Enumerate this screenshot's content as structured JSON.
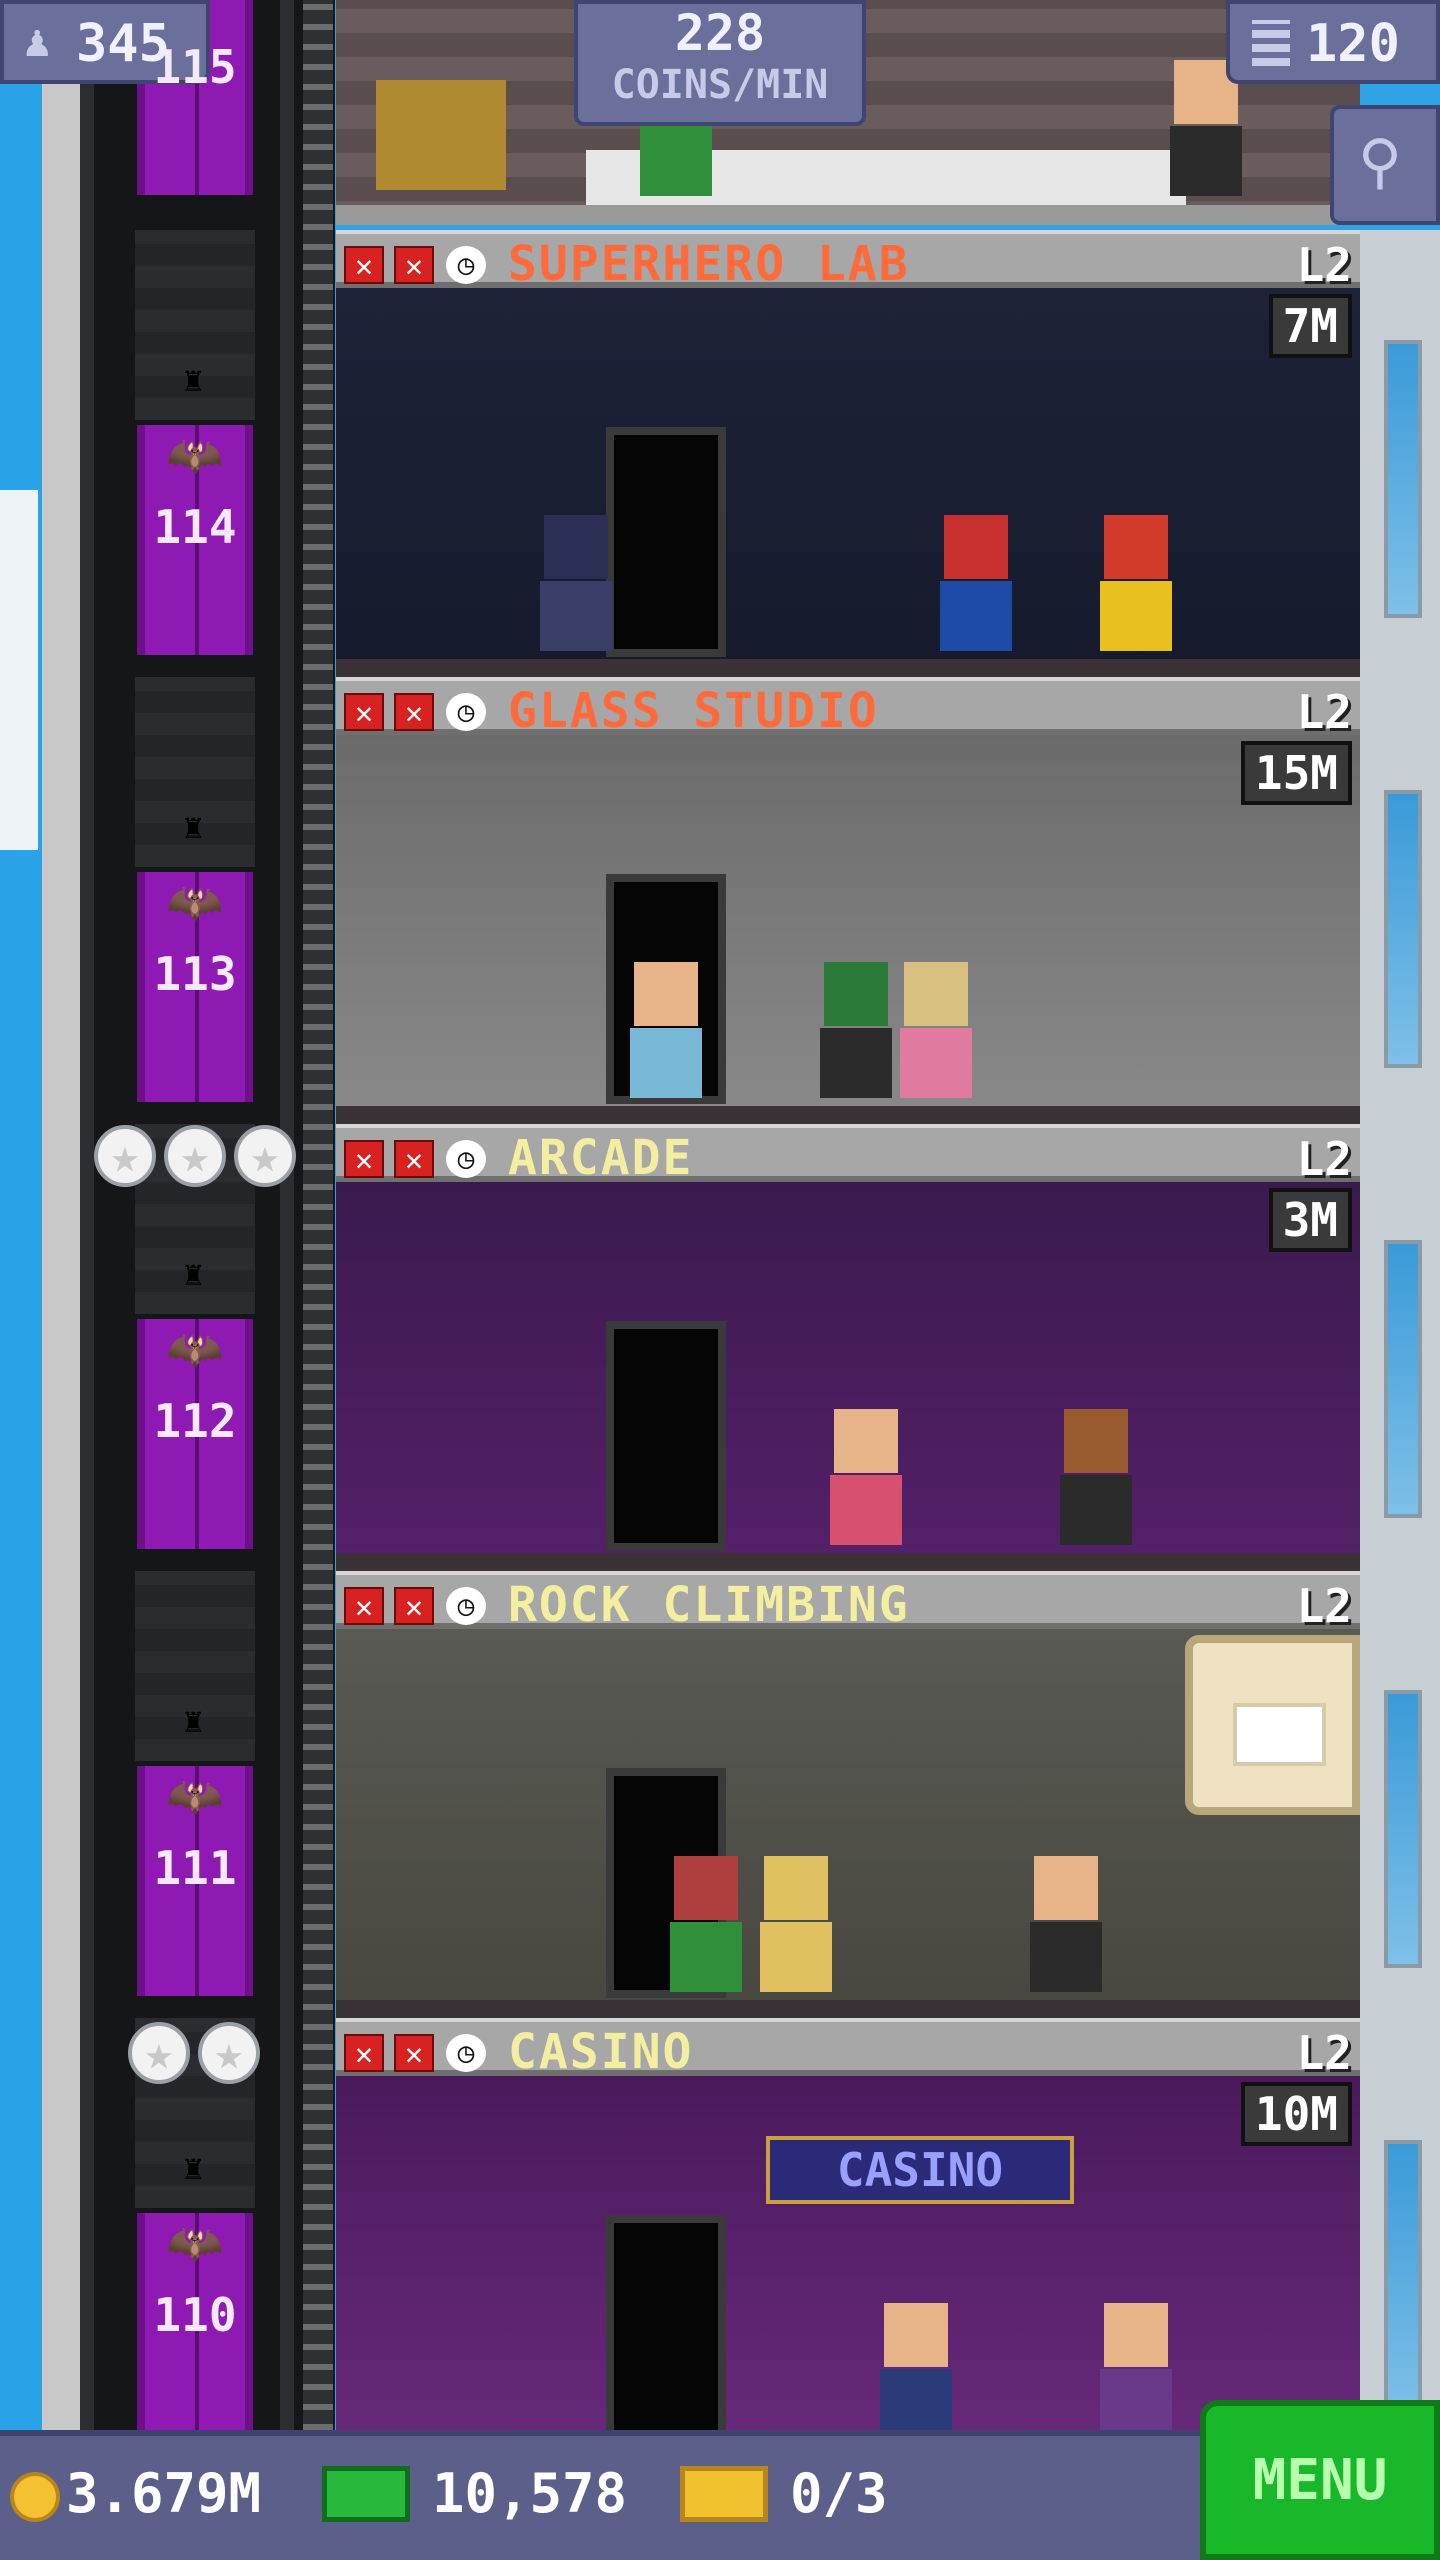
{
  "hud": {
    "population": "345",
    "coins_per_min_value": "228",
    "coins_per_min_label": "COINS/MIN",
    "floors": "120"
  },
  "floors": [
    {
      "name": "SUPERHERO LAB",
      "level": "L2",
      "price": "7M",
      "name_color": "#ff6a3a",
      "elevator_number": "114"
    },
    {
      "name": "GLASS STUDIO",
      "level": "L2",
      "price": "15M",
      "name_color": "#ff6a3a",
      "elevator_number": "113"
    },
    {
      "name": "ARCADE",
      "level": "L2",
      "price": "3M",
      "name_color": "#f4eea0",
      "elevator_number": "112"
    },
    {
      "name": "ROCK CLIMBING",
      "level": "L2",
      "price": "",
      "name_color": "#f4eea0",
      "elevator_number": "111"
    },
    {
      "name": "CASINO",
      "level": "L2",
      "price": "10M",
      "name_color": "#f4eea0",
      "elevator_number": "110"
    }
  ],
  "top_floor_elevator_number": "115",
  "casino_sign": "CASINO",
  "bottom_bar": {
    "coins": "3.679M",
    "bux": "10,578",
    "tickets": "0/3",
    "menu_label": "MENU"
  },
  "icons": {
    "population": "person-icon",
    "floors": "building-icon",
    "search": "magnifier-icon",
    "coins": "coin-icon",
    "bux": "bux-icon",
    "tickets": "ticket-icon",
    "elevator": "bat-icon",
    "status_x": "x-icon",
    "status_clock": "clock-icon",
    "popup": "crate-icon"
  },
  "colors": {
    "elevator_car": "#8f1ab3",
    "menu_button": "#18b82a",
    "hud_panel": "#6a6f9c"
  }
}
